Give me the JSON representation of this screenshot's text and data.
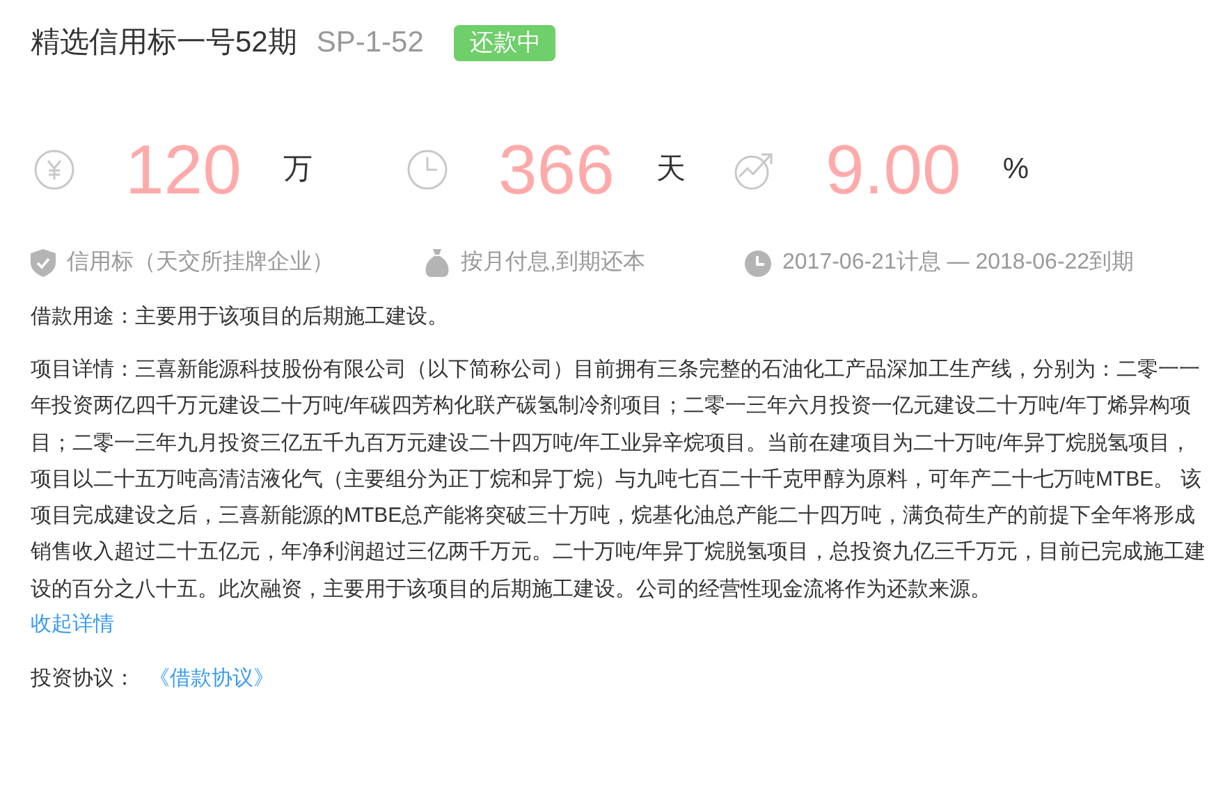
{
  "title": "精选信用标一号52期",
  "code": "SP-1-52",
  "status": {
    "label": "还款中"
  },
  "stats": [
    {
      "kind": "amount",
      "value": "120",
      "unit": "万"
    },
    {
      "kind": "term",
      "value": "366",
      "unit": "天"
    },
    {
      "kind": "rate",
      "value": "9.00",
      "unit": "%"
    }
  ],
  "info": [
    {
      "kind": "shield",
      "text": "信用标（天交所挂牌企业）"
    },
    {
      "kind": "bag",
      "text": "按月付息,到期还本"
    },
    {
      "kind": "clock",
      "text": "2017-06-21计息 — 2018-06-22到期"
    }
  ],
  "purpose": "借款用途：主要用于该项目的后期施工建设。",
  "details": "项目详情：三喜新能源科技股份有限公司（以下简称公司）目前拥有三条完整的石油化工产品深加工生产线，分别为：二零一一年投资两亿四千万元建设二十万吨/年碳四芳构化联产碳氢制冷剂项目；二零一三年六月投资一亿元建设二十万吨/年丁烯异构项目；二零一三年九月投资三亿五千九百万元建设二十四万吨/年工业异辛烷项目。当前在建项目为二十万吨/年异丁烷脱氢项目，项目以二十五万吨高清洁液化气（主要组分为正丁烷和异丁烷）与九吨七百二十千克甲醇为原料，可年产二十七万吨MTBE。 该项目完成建设之后，三喜新能源的MTBE总产能将突破三十万吨，烷基化油总产能二十四万吨，满负荷生产的前提下全年将形成销售收入超过二十五亿元，年净利润超过三亿两千万元。二十万吨/年异丁烷脱氢项目，总投资九亿三千万元，目前已完成施工建设的百分之八十五。此次融资，主要用于该项目的后期施工建设。公司的经营性现金流将作为还款来源。",
  "collapse_link": "收起详情",
  "agreement": {
    "label": "投资协议：",
    "link": "《借款协议》"
  }
}
